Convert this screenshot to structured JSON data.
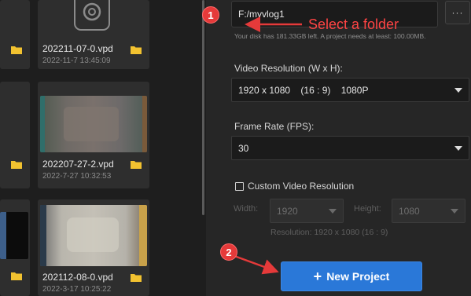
{
  "projects": [
    {
      "name": "202211-07-0.vpd",
      "date": "2022-11-7 13:45:09"
    },
    {
      "name": "202207-27-2.vpd",
      "date": "2022-7-27 10:32:53"
    },
    {
      "name": "202112-08-0.vpd",
      "date": "2022-3-17 10:25:22"
    }
  ],
  "settings": {
    "folder_value": "F:/myvlog1",
    "more_label": "···",
    "disk_note": "Your disk has 181.33GB left. A project needs at least: 100.00MB.",
    "resolution_label": "Video Resolution (W x H):",
    "resolution_value": "1920 x 1080    (16 : 9)    1080P",
    "framerate_label": "Frame Rate (FPS):",
    "framerate_value": "30",
    "custom_label": "Custom Video Resolution",
    "width_label": "Width:",
    "width_value": "1920",
    "height_label": "Height:",
    "height_value": "1080",
    "resolution_summary": "Resolution: 1920 x 1080  (16 : 9)"
  },
  "new_project_label": "New Project",
  "annotations": {
    "step1": "1",
    "step1_text": "Select a folder",
    "step2": "2"
  },
  "colors": {
    "accent": "#2a78d8",
    "annotation": "#e53a3a",
    "folder": "#f2c230"
  },
  "icons": {
    "folder": "folder-icon",
    "project_badge": "project-logo-icon",
    "plus": "plus-icon",
    "dropdown": "chevron-down-icon"
  }
}
